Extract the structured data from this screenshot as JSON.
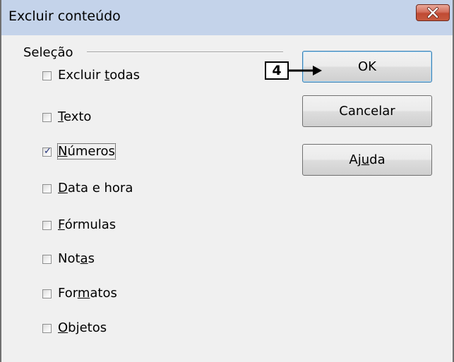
{
  "window": {
    "title": "Excluir conteúdo",
    "close_icon": "close-x-icon",
    "close_button_color": "#c75a3f"
  },
  "selection": {
    "group_label": "Seleção",
    "options": [
      {
        "label_before": "Excluir ",
        "mnemonic": "t",
        "label_after": "odas",
        "checked": false
      },
      {
        "label_before": "",
        "mnemonic": "T",
        "label_after": "exto",
        "checked": false
      },
      {
        "label_before": "",
        "mnemonic": "N",
        "label_after": "úmeros",
        "checked": true
      },
      {
        "label_before": "",
        "mnemonic": "D",
        "label_after": "ata e hora",
        "checked": false
      },
      {
        "label_before": "",
        "mnemonic": "F",
        "label_after": "órmulas",
        "checked": false
      },
      {
        "label_before": "Not",
        "mnemonic": "a",
        "label_after": "s",
        "checked": false
      },
      {
        "label_before": "For",
        "mnemonic": "m",
        "label_after": "atos",
        "checked": false
      },
      {
        "label_before": "",
        "mnemonic": "O",
        "label_after": "bjetos",
        "checked": false
      }
    ]
  },
  "buttons": {
    "ok": {
      "before": "OK",
      "mnemonic": "",
      "after": ""
    },
    "cancel": {
      "before": "Cancelar",
      "mnemonic": "",
      "after": ""
    },
    "help": {
      "before": "Aj",
      "mnemonic": "u",
      "after": "da"
    }
  },
  "annotation": {
    "badge": "4"
  },
  "colors": {
    "titlebar": "#c4d3ea",
    "dialog_bg": "#f0f0f0",
    "check_mark": "#21307a"
  }
}
